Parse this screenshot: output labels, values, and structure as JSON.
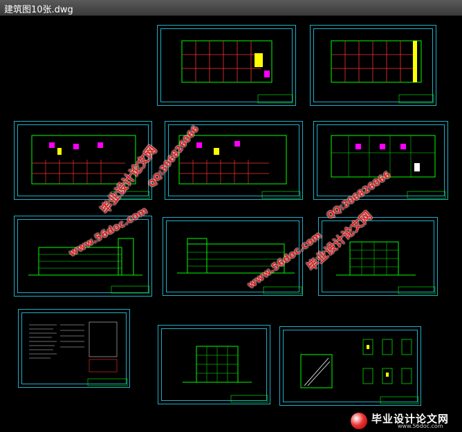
{
  "window": {
    "title": "建筑图10张.dwg"
  },
  "watermarks": {
    "cn_title": "毕业设计论文网",
    "url": "www.56doc.com",
    "qq": "QQ:306826066"
  },
  "logo": {
    "name": "毕业设计论文网",
    "url": "www.56doc.com"
  },
  "colors": {
    "frame": "#1fb0c8",
    "line": "#00ff00",
    "wall": "#ff3030",
    "column": "#ffff00",
    "accent": "#ff00ff",
    "watermark": "#e02020"
  }
}
